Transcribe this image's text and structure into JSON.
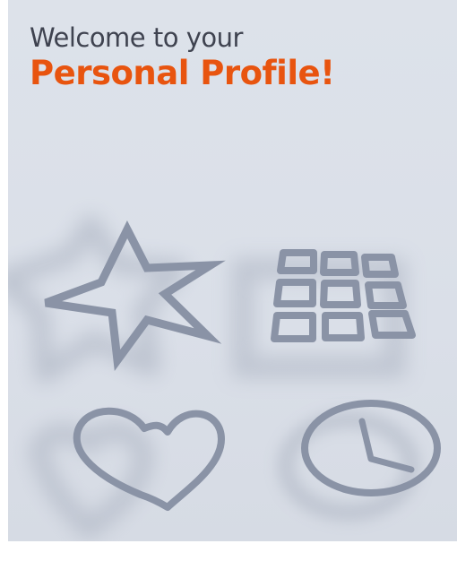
{
  "header": {
    "welcome_text": "Welcome to your",
    "title_text": "Personal Profile!"
  },
  "icons": [
    {
      "name": "star-icon"
    },
    {
      "name": "grid-icon"
    },
    {
      "name": "heart-icon"
    },
    {
      "name": "clock-icon"
    }
  ],
  "colors": {
    "background": "#dce1ea",
    "welcome_text": "#3f4350",
    "title_accent": "#e8540f",
    "icon_stroke": "#8a93a6",
    "icon_shadow": "#9aa2b2"
  }
}
